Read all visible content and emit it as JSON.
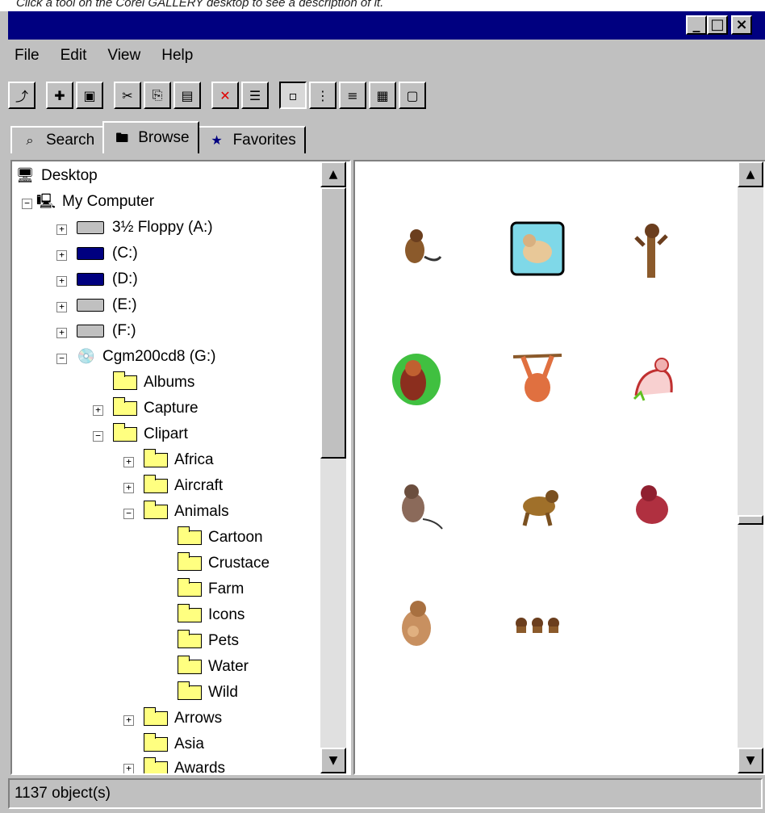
{
  "caption": "Click a tool on the Corel GALLERY desktop to see a description of it.",
  "window": {
    "controls": {
      "minimize": "_",
      "maximize": "□",
      "close": "×"
    }
  },
  "menubar": [
    "File",
    "Edit",
    "View",
    "Help"
  ],
  "toolbar_icons": [
    "up-folder-icon",
    "new-folder-icon",
    "save-icon",
    "cut-icon",
    "copy-icon",
    "paste-icon",
    "delete-icon",
    "properties-icon",
    "large-icons-view-icon",
    "small-icons-view-icon",
    "list-view-icon",
    "details-view-icon",
    "preview-view-icon"
  ],
  "tabs": [
    {
      "label": "Search",
      "icon": "search-icon"
    },
    {
      "label": "Browse",
      "icon": "browse-icon",
      "active": true
    },
    {
      "label": "Favorites",
      "icon": "favorites-icon"
    }
  ],
  "tree": {
    "desktop": "Desktop",
    "my_computer": "My Computer",
    "floppy": "3½ Floppy (A:)",
    "drive_c": "(C:)",
    "drive_d": "(D:)",
    "drive_e": "(E:)",
    "drive_f": "(F:)",
    "cdrom": "Cgm200cd8 (G:)",
    "albums": "Albums",
    "capture": "Capture",
    "clipart": "Clipart",
    "africa": "Africa",
    "aircraft": "Aircraft",
    "animals": "Animals",
    "cartoon": "Cartoon",
    "crustace": "Crustace",
    "farm": "Farm",
    "icons": "Icons",
    "pets": "Pets",
    "water": "Water",
    "wild": "Wild",
    "arrows": "Arrows",
    "asia": "Asia",
    "awards": "Awards"
  },
  "preview": {
    "items": [
      "monkey-clipart-1",
      "monkey-framed-clipart",
      "monkey-climbing-clipart",
      "monkey-green-background-clipart",
      "orangutan-hanging-clipart",
      "monkey-pink-outline-clipart",
      "monkey-sitting-clipart",
      "monkey-walking-clipart",
      "monkey-red-clipart",
      "monkey-with-baby-clipart",
      "three-monkeys-clipart"
    ]
  },
  "status": {
    "text": "1137 object(s)"
  },
  "colors": {
    "titlebar": "#000080",
    "face": "#c0c0c0",
    "folder": "#ffff80"
  }
}
